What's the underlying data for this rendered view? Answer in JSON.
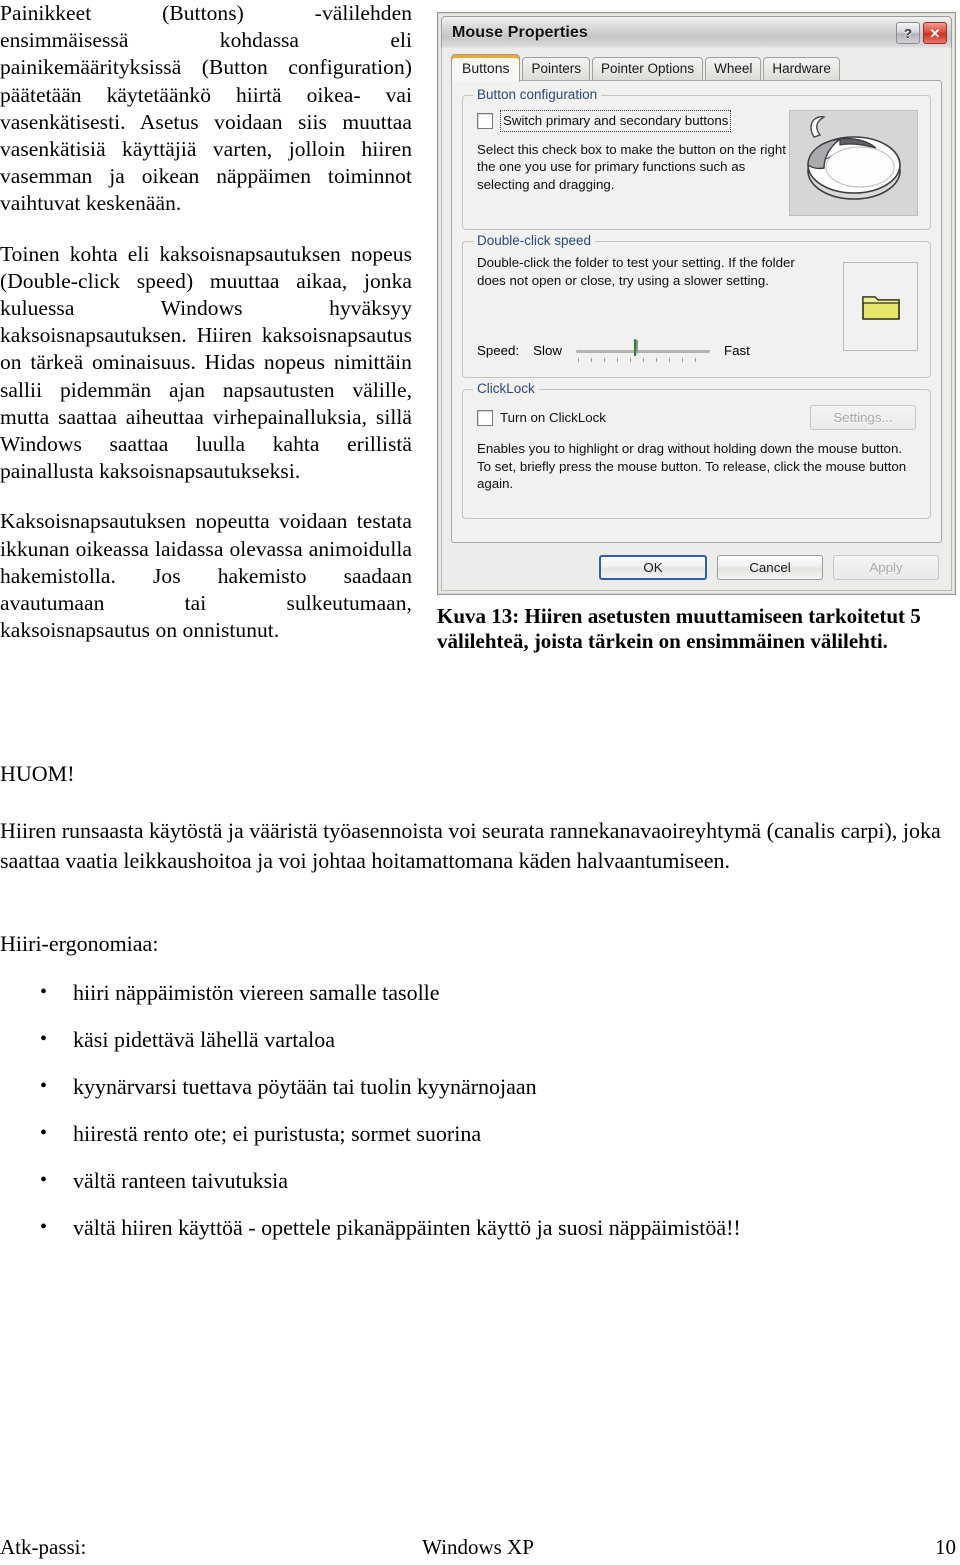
{
  "document": {
    "left_column_paragraphs": [
      "Painikkeet (Buttons) -välilehden ensimmäisessä kohdassa eli painikemäärityksissä (Button configuration) päätetään käytetäänkö hiirtä oikea- vai vasenkätisesti. Asetus voidaan siis muuttaa vasenkätisiä käyttäjiä varten, jolloin hiiren vasemman ja oikean näppäimen toiminnot vaihtuvat keskenään.",
      "Toinen kohta eli kaksoisnapsautuksen nopeus (Double-click speed) muuttaa aikaa, jonka kuluessa Windows hyväksyy kaksoisnapsautuksen. Hiiren kaksoisnapsautus on tärkeä ominaisuus. Hidas nopeus nimittäin sallii pidemmän ajan napsautusten välille, mutta saattaa aiheuttaa virhepainalluksia, sillä Windows saattaa luulla kahta erillistä painallusta kaksoisnapsautukseksi.",
      "Kaksoisnapsautuksen nopeutta voidaan testata ikkunan oikeassa laidassa olevassa animoidulla hakemistolla. Jos hakemisto saadaan avautumaan tai sulkeutumaan, kaksoisnapsautus on onnistunut."
    ],
    "figure_caption": "Kuva 13: Hiiren asetusten muuttamiseen tarkoitetut 5 välilehteä, joista tärkein on ensimmäinen välilehti.",
    "note_heading": "HUOM!",
    "note_body": "Hiiren runsaasta käytöstä ja vääristä työasennoista voi seurata rannekanavaoireyhtymä (canalis carpi), joka saattaa vaatia leikkaushoitoa ja voi johtaa hoitamattomana käden halvaantumiseen.",
    "list_heading": "Hiiri-ergonomiaa:",
    "list_items": [
      "hiiri näppäimistön viereen samalle tasolle",
      "käsi pidettävä lähellä vartaloa",
      "kyynärvarsi tuettava pöytään tai tuolin kyynärnojaan",
      "hiirestä rento ote; ei puristusta; sormet suorina",
      "vältä ranteen taivutuksia",
      "vältä hiiren käyttöä - opettele pikanäppäinten käyttö ja suosi näppäimistöä!!"
    ],
    "footer": {
      "left": "Atk-passi:",
      "center": "Windows XP",
      "right": "10"
    }
  },
  "dialog": {
    "title": "Mouse Properties",
    "help_button_glyph": "?",
    "close_button_glyph": "✕",
    "tabs": [
      {
        "label": "Buttons",
        "active": true
      },
      {
        "label": "Pointers",
        "active": false
      },
      {
        "label": "Pointer Options",
        "active": false
      },
      {
        "label": "Wheel",
        "active": false
      },
      {
        "label": "Hardware",
        "active": false
      }
    ],
    "button_configuration": {
      "group_label": "Button configuration",
      "checkbox_label": "Switch primary and secondary buttons",
      "checkbox_checked": false,
      "description": "Select this check box to make the button on the right the one you use for primary functions such as selecting and dragging."
    },
    "double_click_speed": {
      "group_label": "Double-click speed",
      "description": "Double-click the folder to test your setting. If the folder does not open or close, try using a slower setting.",
      "speed_label": "Speed:",
      "slow_label": "Slow",
      "fast_label": "Fast",
      "slider_position_percent": 48
    },
    "clicklock": {
      "group_label": "ClickLock",
      "checkbox_label": "Turn on ClickLock",
      "checkbox_checked": false,
      "settings_button": "Settings...",
      "settings_disabled": true,
      "description": "Enables you to highlight or drag without holding down the mouse button. To set, briefly press the mouse button. To release, click the mouse button again."
    },
    "footer_buttons": [
      {
        "label": "OK",
        "style": "default"
      },
      {
        "label": "Cancel",
        "style": "normal"
      },
      {
        "label": "Apply",
        "style": "disabled"
      }
    ],
    "colors": {
      "titlebar_gradient_top": "#f2f2f2",
      "titlebar_gradient_bottom": "#eeeef0",
      "close_button_red": "#cf3126",
      "active_tab_accent": "#f0a830",
      "group_label_blue": "#2b4a78",
      "slider_thumb_green": "#2e9b3d",
      "folder_icon_yellow": "#e3e34c",
      "default_button_border": "#2f5ea8"
    }
  }
}
